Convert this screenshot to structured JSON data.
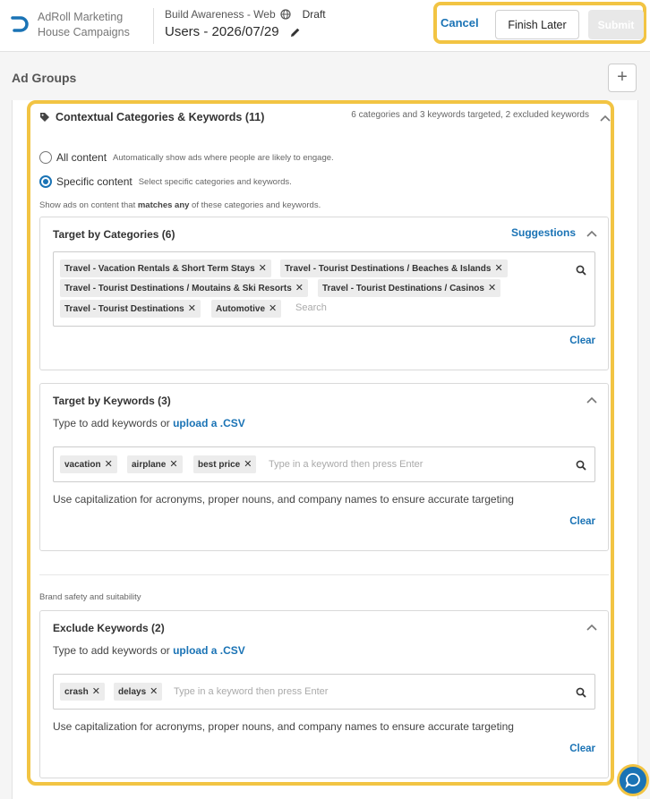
{
  "header": {
    "org_line1": "AdRoll Marketing",
    "org_line2": "House Campaigns",
    "campaign_name": "Build Awareness - Web",
    "status": "Draft",
    "page_title": "Users - 2026/07/29",
    "cancel_label": "Cancel",
    "finish_later_label": "Finish Later",
    "submit_label": "Submit"
  },
  "ad_groups": {
    "title": "Ad Groups",
    "add_label": "+"
  },
  "section": {
    "title": "Contextual Categories & Keywords (11)",
    "summary": "6 categories and 3 keywords targeted, 2 excluded keywords",
    "all_content_label": "All content",
    "all_content_desc": "Automatically show ads where people are likely to engage.",
    "specific_content_label": "Specific content",
    "specific_content_desc": "Select specific categories and keywords.",
    "matches_pre": "Show ads on content that ",
    "matches_bold": "matches any",
    "matches_post": " of these categories and keywords."
  },
  "categories": {
    "title": "Target by Categories (6)",
    "suggestions_label": "Suggestions",
    "chips": [
      "Travel - Vacation Rentals & Short Term Stays",
      "Travel - Tourist Destinations / Beaches & Islands",
      "Travel - Tourist Destinations / Moutains & Ski Resorts",
      "Travel - Tourist Destinations / Casinos",
      "Travel - Tourist Destinations",
      "Automotive"
    ],
    "placeholder": "Search",
    "clear_label": "Clear"
  },
  "keywords": {
    "title": "Target by Keywords (3)",
    "hint_pre": "Type to add keywords or ",
    "hint_link": "upload a .CSV",
    "chips": [
      "vacation",
      "airplane",
      "best price"
    ],
    "placeholder": "Type in a keyword then press Enter",
    "note": "Use capitalization for acronyms, proper nouns, and company names to ensure accurate targeting",
    "clear_label": "Clear"
  },
  "brand_safety": {
    "label": "Brand safety and suitability"
  },
  "exclude": {
    "title": "Exclude Keywords (2)",
    "hint_pre": "Type to add keywords or ",
    "hint_link": "upload a .CSV",
    "chips": [
      "crash",
      "delays"
    ],
    "placeholder": "Type in a keyword then press Enter",
    "note": "Use capitalization for acronyms, proper nouns, and company names to ensure accurate targeting",
    "clear_label": "Clear"
  },
  "colors": {
    "accent": "#1a73b5",
    "highlight": "#f2c443"
  }
}
